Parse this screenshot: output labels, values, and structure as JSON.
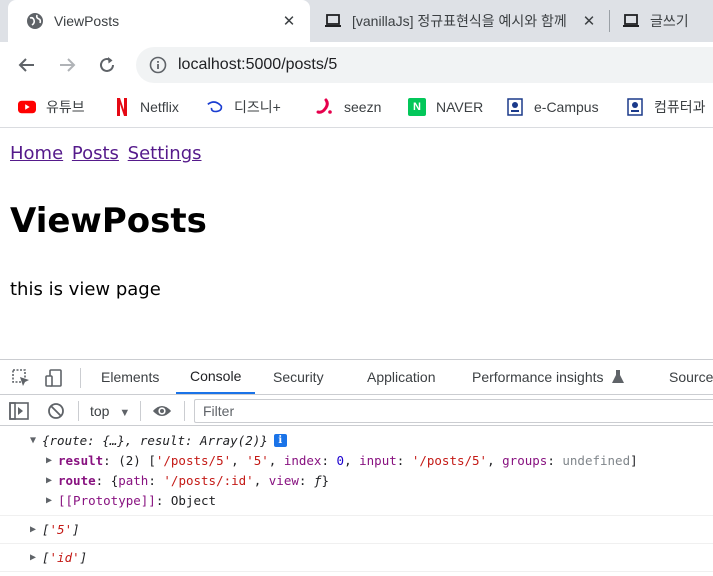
{
  "browser": {
    "tabs": [
      {
        "title": "ViewPosts",
        "active": true
      },
      {
        "title": "[vanillaJs] 정규표현식을 예시와 함께",
        "active": false
      },
      {
        "title": "글쓰기",
        "active": false
      }
    ],
    "url": "localhost:5000/posts/5",
    "bookmarks": [
      {
        "label": "유튜브",
        "icon": "youtube-icon",
        "color": "#ff0000"
      },
      {
        "label": "Netflix",
        "icon": "netflix-icon",
        "color": "#e50914"
      },
      {
        "label": "디즈니+",
        "icon": "disney-plus-icon",
        "color": "#1a3dd1"
      },
      {
        "label": "seezn",
        "icon": "seezn-icon",
        "color": "#e6004c"
      },
      {
        "label": "NAVER",
        "icon": "naver-icon",
        "color": "#03c75a"
      },
      {
        "label": "e-Campus",
        "icon": "ecampus-icon",
        "color": "#1b3a8a"
      },
      {
        "label": "컴퓨터과",
        "icon": "dept-icon",
        "color": "#1b3a8a"
      }
    ]
  },
  "page": {
    "nav": [
      "Home",
      "Posts",
      "Settings"
    ],
    "heading": "ViewPosts",
    "text": "this is view page"
  },
  "devtools": {
    "tabs": [
      "Elements",
      "Console",
      "Security",
      "Application",
      "Performance insights",
      "Sources"
    ],
    "active_tab": "Console",
    "context": "top",
    "filter_placeholder": "Filter",
    "log": {
      "entry1_summary_route": "route: {…}, ",
      "entry1_summary_result": "result: Array(2)}",
      "result_line": {
        "key": "result",
        "count": "(2) [",
        "v1": "'/posts/5'",
        "v2": "'5'",
        "index_key": "index",
        "index_val": "0",
        "input_key": "input",
        "input_val": "'/posts/5'",
        "groups_key": "groups",
        "groups_val": "undefined"
      },
      "route_line": {
        "key": "route",
        "path_key": "path",
        "path_val": "'/posts/:id'",
        "view_key": "view",
        "view_val": "ƒ"
      },
      "proto_key": "[[Prototype]]",
      "proto_val": "Object",
      "entry2": "'5'",
      "entry3": "'id'"
    }
  },
  "colors": {
    "tab_strip": "#dee1e6",
    "link_visited": "#551a8b",
    "devtools_accent": "#1a73e8"
  }
}
